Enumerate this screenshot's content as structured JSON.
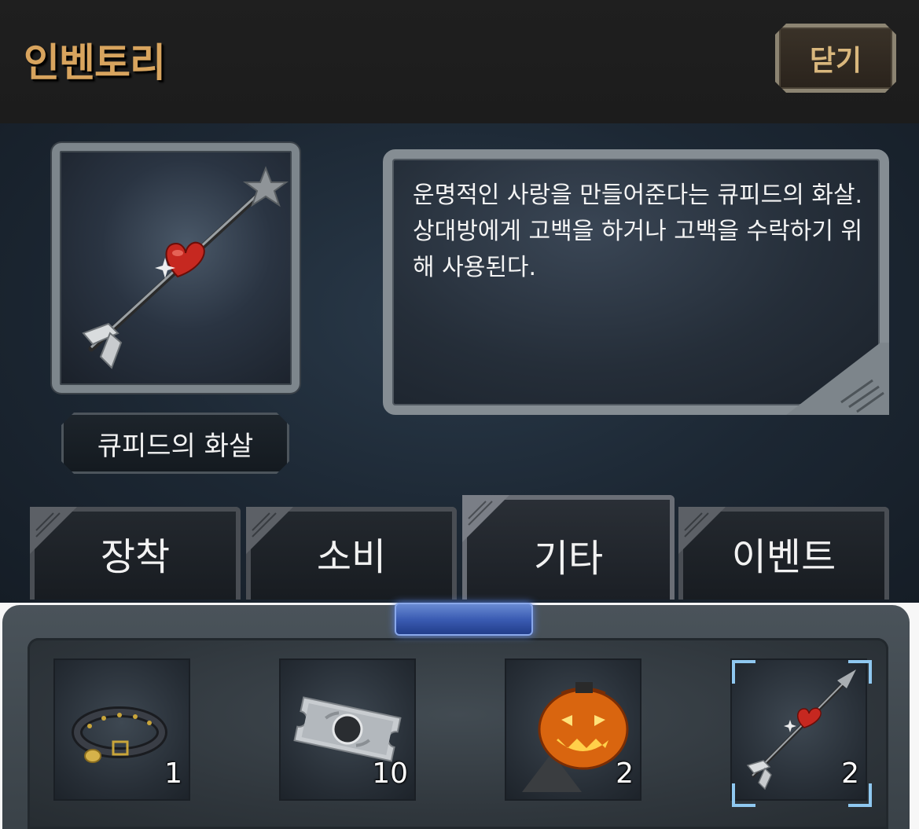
{
  "header": {
    "title": "인벤토리",
    "close_label": "닫기"
  },
  "selected_item": {
    "name": "큐피드의 화살",
    "description": "운명적인 사랑을 만들어준다는 큐피드의 화살. 상대방에게 고백을 하거나 고백을 수락하기 위해 사용된다.",
    "icon": "cupid-arrow-icon"
  },
  "tabs": [
    {
      "label": "장착",
      "active": false
    },
    {
      "label": "소비",
      "active": false
    },
    {
      "label": "기타",
      "active": true
    },
    {
      "label": "이벤트",
      "active": false
    }
  ],
  "inventory": {
    "slots": [
      {
        "icon": "collar-icon",
        "count": "1",
        "selected": false
      },
      {
        "icon": "ticket-icon",
        "count": "10",
        "selected": false
      },
      {
        "icon": "pumpkin-icon",
        "count": "2",
        "selected": false
      },
      {
        "icon": "cupid-arrow-icon",
        "count": "2",
        "selected": true
      }
    ]
  },
  "colors": {
    "title": "#d8a45e",
    "close_text": "#d9b77d",
    "selection": "#8fc8f0",
    "gem": "#3b5cb3"
  }
}
